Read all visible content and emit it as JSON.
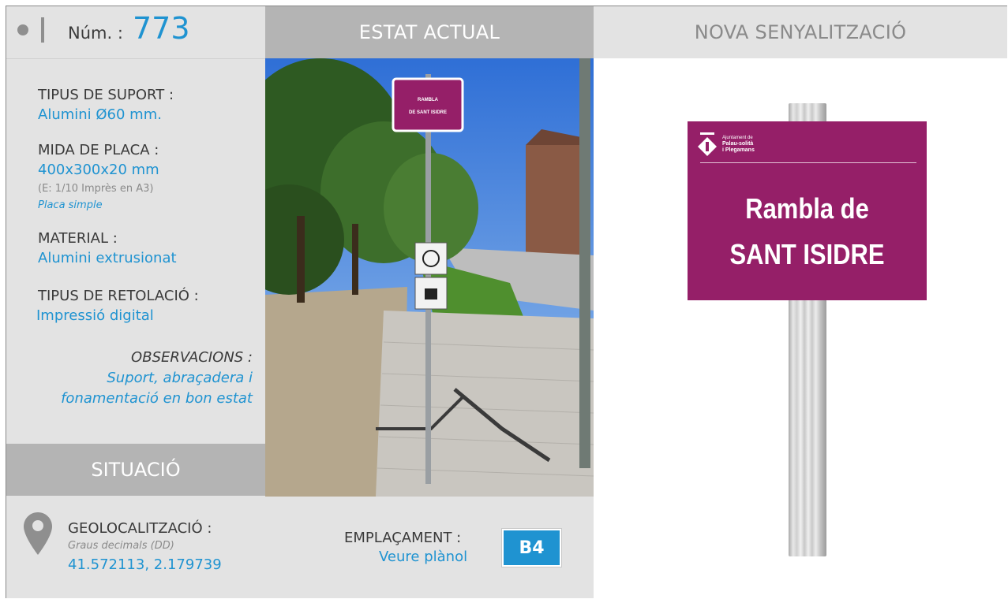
{
  "header": {
    "num_label": "Núm. :",
    "num_value": "773",
    "estat_actual": "ESTAT ACTUAL",
    "nova_senyalitzacio": "NOVA SENYALITZACIÓ"
  },
  "specs": {
    "tipus_suport_label": "TIPUS DE SUPORT :",
    "tipus_suport_value": "Alumini Ø60 mm.",
    "mida_placa_label": "MIDA DE PLACA :",
    "mida_placa_value": "400x300x20 mm",
    "mida_placa_scale": "(E: 1/10 Imprès en A3)",
    "mida_placa_type": "Placa simple",
    "material_label": "MATERIAL :",
    "material_value": "Alumini extrusionat",
    "retolacio_label": "TIPUS DE RETOLACIÓ :",
    "retolacio_value": "Impressió digital",
    "observacions_label": "OBSERVACIONS :",
    "observacions_line1": "Suport, abraçadera i",
    "observacions_line2": "fonamentació en bon estat"
  },
  "situacio": {
    "title": "SITUACIÓ",
    "geo_label": "GEOLOCALITZACIÓ :",
    "geo_format": "Graus decimals (DD)",
    "geo_value": "41.572113, 2.179739",
    "emplacament_label": "EMPLAÇAMENT :",
    "emplacament_link": "Veure plànol",
    "emplacament_code": "B4"
  },
  "photo": {
    "sign_line1": "RAMBLA",
    "sign_line2": "DE SANT ISIDRE"
  },
  "new_sign": {
    "logo_line1": "Ajuntament de",
    "logo_line2": "Palau-solità",
    "logo_line3": "i Plegamans",
    "title_line1": "Rambla de",
    "title_line2": "SANT ISIDRE",
    "plate_color": "#951f68"
  },
  "colors": {
    "accent_blue": "#1f93d1",
    "panel_grey": "#e3e3e3",
    "header_grey": "#b4b4b4"
  }
}
